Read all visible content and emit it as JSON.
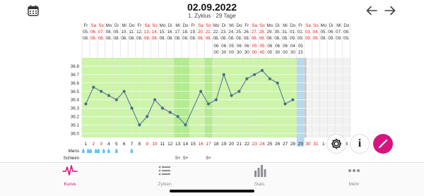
{
  "header": {
    "date": "02.09.2022",
    "cycle_info": "1. Zyklus · 29 Tage",
    "calendar_icon": "calendar-icon",
    "back_icon": "arrow-left-icon",
    "forward_icon": "arrow-right-icon"
  },
  "calendar": {
    "weekdays": [
      "Fr",
      "Sa",
      "So",
      "Mo",
      "Di",
      "Mi",
      "Do",
      "Fr",
      "Sa",
      "So",
      "Mo",
      "Di",
      "Mi",
      "Do",
      "Fr",
      "Sa",
      "So",
      "Mo",
      "Di",
      "Mi",
      "Do",
      "Fr",
      "Sa",
      "So",
      "Mo",
      "Di",
      "Mi",
      "Do",
      "Fr",
      "Sa",
      "So",
      "Mo",
      "Di",
      "Mi",
      "Do"
    ],
    "dates": [
      "05.",
      "06.",
      "07.",
      "08.",
      "09.",
      "10.",
      "11.",
      "12.",
      "13.",
      "14.",
      "15.",
      "16.",
      "17.",
      "18.",
      "19.",
      "20.",
      "21.",
      "22.",
      "23.",
      "24.",
      "25.",
      "26.",
      "27.",
      "28.",
      "29.",
      "30.",
      "31.",
      "01.",
      "02.",
      "03.",
      "04.",
      "05.",
      "06.",
      "07.",
      "08."
    ],
    "months": [
      "08.",
      "08.",
      "08.",
      "08.",
      "08.",
      "08.",
      "08.",
      "08.",
      "08.",
      "08.",
      "08.",
      "08.",
      "08.",
      "08.",
      "08.",
      "08.",
      "08.",
      "08.",
      "08.",
      "08.",
      "08.",
      "08.",
      "08.",
      "08.",
      "08.",
      "08.",
      "08.",
      "09.",
      "09.",
      "09.",
      "09.",
      "09.",
      "09.",
      "09.",
      "09."
    ],
    "times_hour": [
      "",
      "",
      "",
      "",
      "",
      "",
      "",
      "",
      "",
      "",
      "",
      "",
      "",
      "",
      "",
      "",
      "",
      "06",
      "06",
      "05",
      "06",
      "06",
      "05",
      "05",
      "06",
      "06",
      "06",
      "04",
      "05",
      "",
      "",
      "",
      "",
      "",
      ""
    ],
    "times_min": [
      "",
      "",
      "",
      "",
      "",
      "",
      "",
      "",
      "",
      "",
      "",
      "",
      "",
      "",
      "",
      "",
      "",
      "00",
      "30",
      "00",
      "30",
      "30",
      "00",
      "45",
      "00",
      "30",
      "00",
      "30",
      "15",
      "",
      "",
      "",
      "",
      "",
      ""
    ],
    "weekend_color": "#e0211b"
  },
  "chart_data": {
    "type": "line",
    "title": "",
    "xlabel": "",
    "ylabel": "",
    "ylim": [
      35.95,
      36.9
    ],
    "y_ticks": [
      "36.8",
      "36.7",
      "36.6",
      "36.5",
      "36.4",
      "36.3",
      "36.2",
      "36.1",
      "36.0"
    ],
    "cycle_days": [
      "1",
      "2",
      "3",
      "4",
      "5",
      "6",
      "7",
      "8",
      "9",
      "10",
      "11",
      "12",
      "13",
      "14",
      "15",
      "16",
      "17",
      "18",
      "19",
      "20",
      "21",
      "22",
      "23",
      "24",
      "25",
      "26",
      "27",
      "28",
      "29",
      "30",
      "31",
      "1",
      "2",
      "3",
      "4"
    ],
    "day_colors": [
      "#222",
      "#e0211b",
      "#e0211b",
      "#222",
      "#222",
      "#222",
      "#222",
      "#222",
      "#e0211b",
      "#e0211b",
      "#222",
      "#222",
      "#222",
      "#222",
      "#222",
      "#e0211b",
      "#e0211b",
      "#222",
      "#222",
      "#222",
      "#222",
      "#222",
      "#e0211b",
      "#e0211b",
      "#222",
      "#222",
      "#222",
      "#222",
      "#222",
      "#e0211b",
      "#e0211b",
      "#222",
      "#222",
      "#222",
      "#222"
    ],
    "series": [
      {
        "values": [
          36.35,
          36.55,
          36.5,
          36.45,
          36.4,
          36.5,
          36.3,
          36.1,
          36.2,
          36.4,
          36.3,
          36.25,
          36.2,
          36.1,
          null,
          36.5,
          36.35,
          36.4,
          36.7,
          36.45,
          36.5,
          36.65,
          36.7,
          36.75,
          36.65,
          36.6,
          36.35,
          36.4
        ]
      }
    ],
    "grid": true,
    "colors": {
      "fertile": "#ccf5a8",
      "fertile_peak": "#b2ec8c",
      "line": "#4a6d8c",
      "today": "#b7d9ee"
    }
  },
  "rows": {
    "mens_label": "Mens",
    "schleim_label": "Schleim",
    "mens_symbols": [
      "💧💧",
      "💧💧",
      "💧💧",
      "💧",
      "💧",
      "",
      "💧"
    ],
    "schleim_marks": {
      "13": "S+",
      "14": "S+",
      "17": "S+"
    }
  },
  "actions": {
    "settings_icon": "gear-icon",
    "info_icon": "info-icon",
    "info_label": "i",
    "edit_icon": "pencil-icon",
    "accent": "#d6147e"
  },
  "tabs": [
    {
      "label": "Kurve",
      "icon": "heartbeat-icon",
      "active": true
    },
    {
      "label": "Zyklen",
      "icon": "list-icon",
      "active": false
    },
    {
      "label": "Stats",
      "icon": "bar-chart-icon",
      "active": false
    },
    {
      "label": "Mehr",
      "icon": "more-dots-icon",
      "active": false
    }
  ]
}
